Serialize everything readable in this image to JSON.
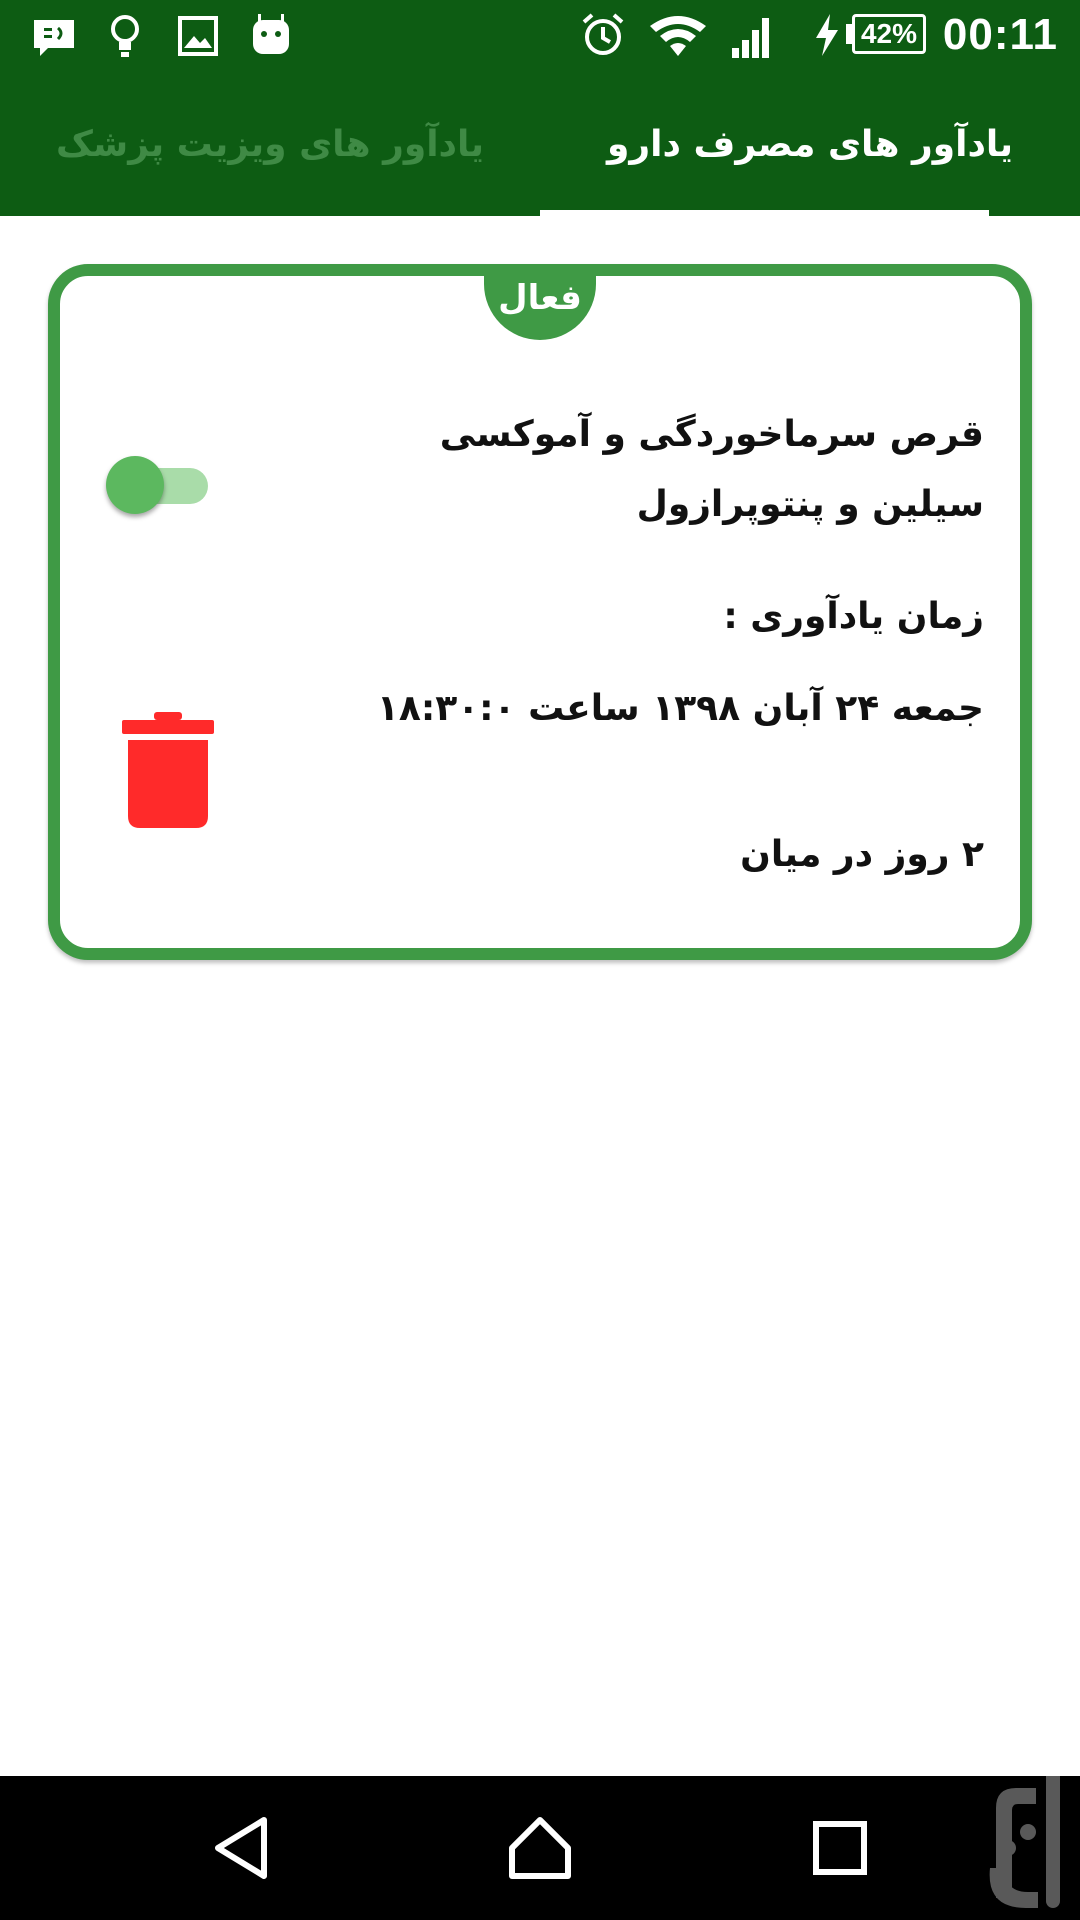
{
  "status_bar": {
    "time": "00:11",
    "battery_percent": "42%",
    "icons": [
      "message-icon",
      "lightbulb-icon",
      "image-icon",
      "android-icon",
      "alarm-icon",
      "wifi-icon",
      "signal-icon",
      "charging-icon",
      "battery-icon"
    ]
  },
  "tabs": {
    "active_label": "یادآور های مصرف دارو",
    "inactive_label": "یادآور های ویزیت پزشک"
  },
  "card": {
    "badge": "فعال",
    "medicine_name": "قرص سرماخوردگی و آموکسی سیلین و پنتوپرازول",
    "reminder_label": "زمان یادآوری :",
    "reminder_time": "جمعه  ۲۴  آبان  ۱۳۹۸ ساعت ۱۸:۳۰:۰",
    "interval": "۲ روز در میان",
    "toggle_on": true
  },
  "colors": {
    "primary_dark": "#0d5c13",
    "accent": "#3f9a45",
    "delete": "#ff2a2a"
  },
  "nav_bar": {
    "icons": [
      "back-icon",
      "home-icon",
      "recents-icon"
    ]
  }
}
